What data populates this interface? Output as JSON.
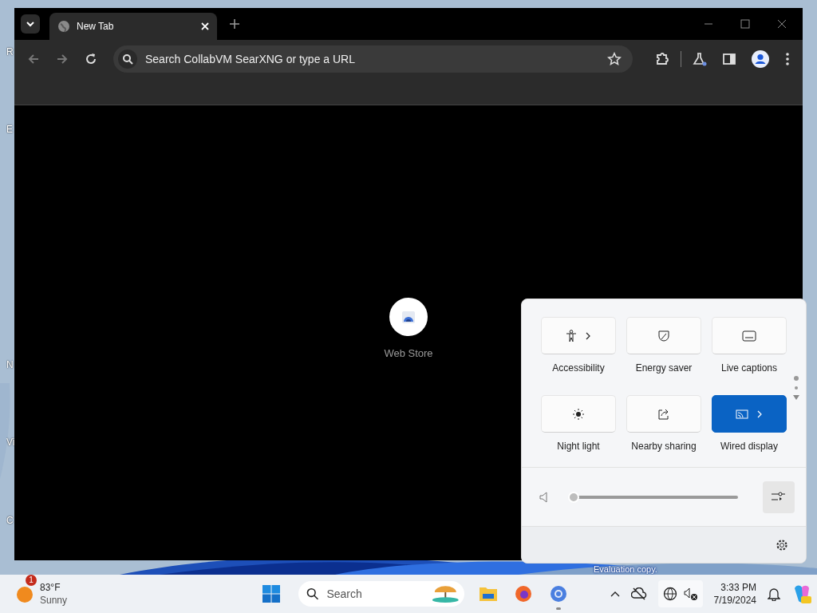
{
  "desktop": {
    "icon_labels": [
      "R",
      "E",
      "N",
      "Vi",
      "C"
    ],
    "watermark_text": "Evaluation copy."
  },
  "browser": {
    "tabs": [
      {
        "title": "New Tab",
        "selected": true
      }
    ],
    "address_bar": {
      "placeholder": "Search CollabVM SearXNG or type a URL"
    },
    "shortcuts": [
      {
        "label": "Web Store"
      }
    ]
  },
  "quick_settings": {
    "tiles": [
      {
        "kind": "accessibility",
        "label": "Accessibility",
        "on": false,
        "has_arrow": true
      },
      {
        "kind": "energy",
        "label": "Energy saver",
        "on": false,
        "has_arrow": false
      },
      {
        "kind": "captions",
        "label": "Live captions",
        "on": false,
        "has_arrow": false
      },
      {
        "kind": "sun",
        "label": "Night light",
        "on": false,
        "has_arrow": false
      },
      {
        "kind": "share",
        "label": "Nearby sharing",
        "on": false,
        "has_arrow": false
      },
      {
        "kind": "cast",
        "label": "Wired display",
        "on": true,
        "has_arrow": true
      }
    ],
    "volume": {
      "level": 0
    }
  },
  "taskbar": {
    "weather": {
      "badge": "1",
      "temperature": "83°F",
      "condition": "Sunny"
    },
    "search": {
      "placeholder": "Search"
    },
    "apps": [
      {
        "kind": "files",
        "running": false
      },
      {
        "kind": "firefox",
        "running": false
      },
      {
        "kind": "chrome",
        "running": true
      }
    ],
    "clock": {
      "time": "3:33 PM",
      "date": "7/19/2024"
    }
  }
}
